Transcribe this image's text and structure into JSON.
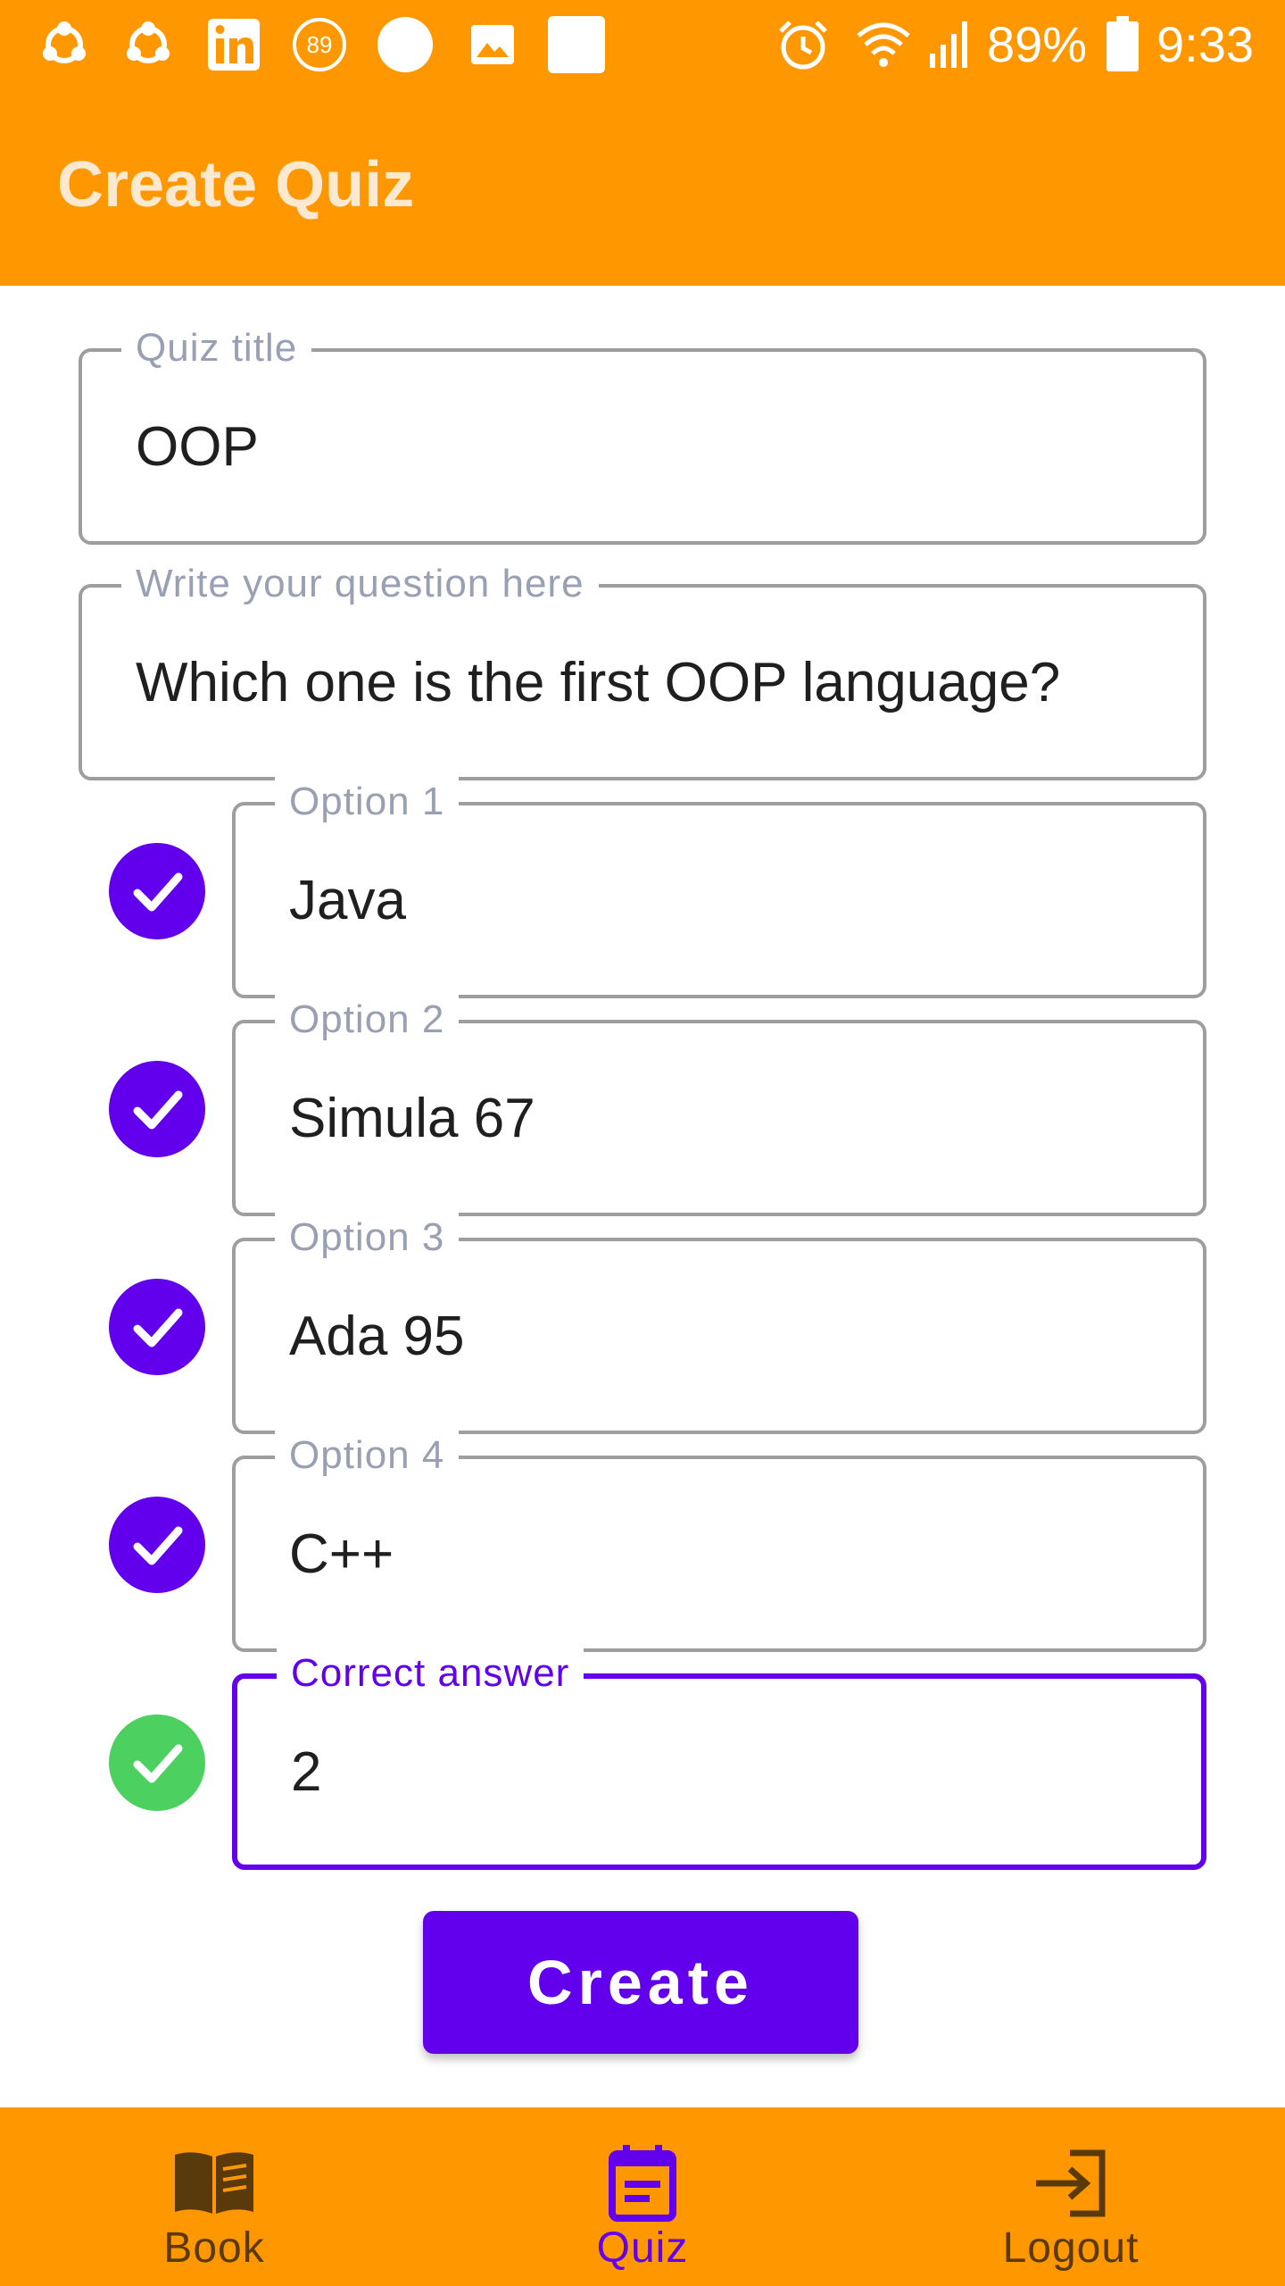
{
  "status_bar": {
    "battery_percent": "89%",
    "time": "9:33",
    "badge_count": "89",
    "icons": [
      "share-icon",
      "share-icon",
      "linkedin-icon",
      "notification-badge-icon",
      "circle-icon",
      "image-icon",
      "square-icon",
      "alarm-icon",
      "wifi-icon",
      "signal-icon",
      "battery-icon"
    ]
  },
  "app_bar": {
    "title": "Create Quiz"
  },
  "form": {
    "quiz_title": {
      "label": "Quiz title",
      "value": "OOP"
    },
    "question": {
      "label": "Write your question here",
      "value": "Which one is the first OOP language?"
    },
    "options": [
      {
        "label": "Option 1",
        "value": "Java"
      },
      {
        "label": "Option 2",
        "value": "Simula 67"
      },
      {
        "label": "Option 3",
        "value": "Ada 95"
      },
      {
        "label": "Option 4",
        "value": "C++"
      }
    ],
    "correct_answer": {
      "label": "Correct answer",
      "value": "2"
    },
    "create_label": "Create"
  },
  "bottom_nav": {
    "items": [
      {
        "label": "Book",
        "icon": "book-icon",
        "active": false
      },
      {
        "label": "Quiz",
        "icon": "quiz-icon",
        "active": true
      },
      {
        "label": "Logout",
        "icon": "logout-icon",
        "active": false
      }
    ]
  },
  "colors": {
    "primary": "#6200ee",
    "app_bar": "#ff9800",
    "success": "#4cd060",
    "outline": "#9e9e9e"
  }
}
